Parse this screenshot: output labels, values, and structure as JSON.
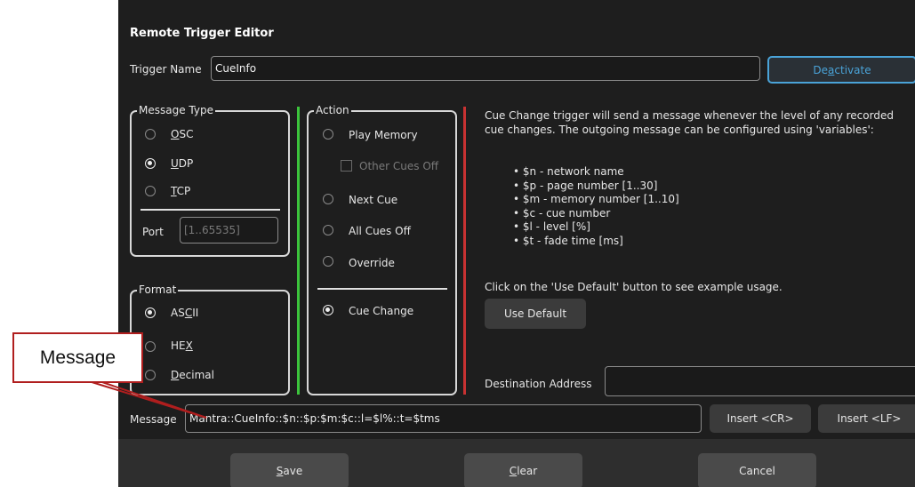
{
  "dialog": {
    "title": "Remote Trigger Editor",
    "trigger_name_label": "Trigger Name",
    "trigger_name_value": "CueInfo",
    "deactivate": {
      "pre": "De",
      "key": "a",
      "post": "ctivate"
    }
  },
  "message_type": {
    "legend": "Message Type",
    "options": [
      {
        "key": "O",
        "rest": "SC",
        "selected": false
      },
      {
        "key": "U",
        "rest": "DP",
        "selected": true
      },
      {
        "key": "T",
        "rest": "CP",
        "selected": false
      }
    ],
    "port_label": "Port",
    "port_placeholder": "[1..65535]"
  },
  "format": {
    "legend": "Format",
    "options": [
      {
        "pre": "AS",
        "key": "C",
        "post": "II",
        "selected": true
      },
      {
        "pre": "HE",
        "key": "X",
        "post": "",
        "selected": false
      },
      {
        "pre": "",
        "key": "D",
        "post": "ecimal",
        "selected": false
      }
    ]
  },
  "action": {
    "legend": "Action",
    "play_memory": "Play Memory",
    "other_cues_off": "Other Cues Off",
    "next_cue": "Next Cue",
    "all_cues_off": "All Cues Off",
    "override": "Override",
    "cue_change": "Cue Change",
    "selected": "cue_change"
  },
  "description": {
    "text": "Cue Change trigger will send a message whenever the level of any recorded cue changes. The outgoing message can be configured using 'variables':",
    "variables": [
      "• $n - network name",
      "• $p - page number [1..30]",
      "• $m - memory number [1..10]",
      "• $c - cue number",
      "• $l - level [%]",
      "• $t - fade time [ms]"
    ],
    "hint": "Click on the 'Use Default' button to see example usage.",
    "use_default": "Use Default"
  },
  "destination": {
    "label": "Destination Address",
    "value": ""
  },
  "message": {
    "label": "Message",
    "value": "Mantra::CueInfo::$n::$p:$m:$c::l=$l%::t=$tms",
    "insert_cr": "Insert <CR>",
    "insert_lf": "Insert <LF>"
  },
  "footer": {
    "save": {
      "key": "S",
      "rest": "ave"
    },
    "clear": {
      "key": "C",
      "rest": "lear"
    },
    "cancel": "Cancel"
  },
  "annotation": {
    "callout_text": "Message",
    "color": "#b01e1e"
  },
  "colors": {
    "accent": "#4aa3d8",
    "green_divider": "#3cc43c",
    "red_divider": "#c83232"
  }
}
